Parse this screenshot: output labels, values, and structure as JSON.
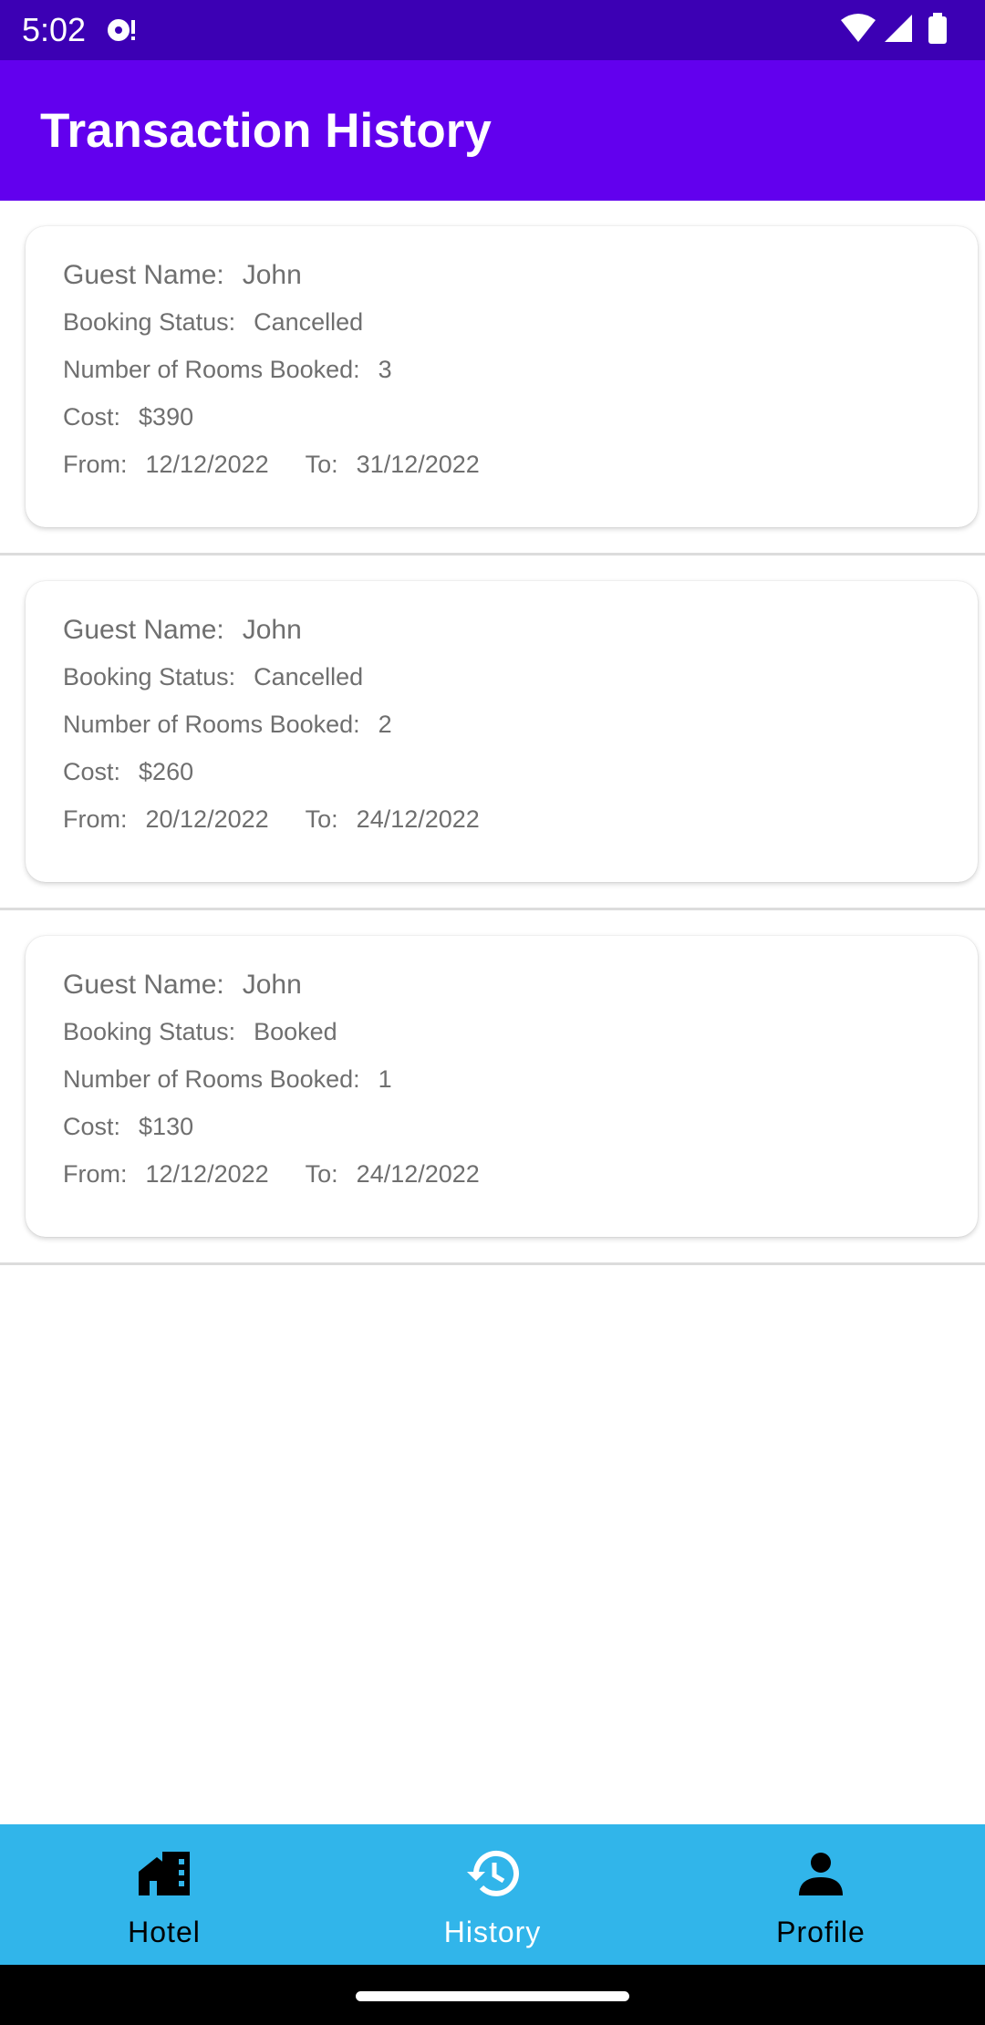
{
  "status_bar": {
    "time": "5:02"
  },
  "app_bar": {
    "title": "Transaction History"
  },
  "transactions": [
    {
      "guest_label": "Guest Name:",
      "guest": "John",
      "status_label": "Booking Status:",
      "status": "Cancelled",
      "rooms_label": "Number of Rooms Booked:",
      "rooms": "3",
      "cost_label": "Cost:",
      "cost": "$390",
      "from_label": "From:",
      "from": "12/12/2022",
      "to_label": "To:",
      "to": "31/12/2022"
    },
    {
      "guest_label": "Guest Name:",
      "guest": "John",
      "status_label": "Booking Status:",
      "status": "Cancelled",
      "rooms_label": "Number of Rooms Booked:",
      "rooms": "2",
      "cost_label": "Cost:",
      "cost": "$260",
      "from_label": "From:",
      "from": "20/12/2022",
      "to_label": "To:",
      "to": "24/12/2022"
    },
    {
      "guest_label": "Guest Name:",
      "guest": "John",
      "status_label": "Booking Status:",
      "status": "Booked",
      "rooms_label": "Number of Rooms Booked:",
      "rooms": "1",
      "cost_label": "Cost:",
      "cost": "$130",
      "from_label": "From:",
      "from": "12/12/2022",
      "to_label": "To:",
      "to": "24/12/2022"
    }
  ],
  "bottom_nav": {
    "items": [
      {
        "label": "Hotel",
        "icon": "hotel-icon",
        "selected": false
      },
      {
        "label": "History",
        "icon": "history-icon",
        "selected": true
      },
      {
        "label": "Profile",
        "icon": "profile-icon",
        "selected": false
      }
    ]
  },
  "colors": {
    "status_bar": "#3c00b4",
    "app_bar": "#6200ee",
    "bottom_nav": "#31b5ea",
    "text_secondary": "#6f6f6f",
    "nav_selected": "#ffffff",
    "nav_unselected": "#000000"
  }
}
